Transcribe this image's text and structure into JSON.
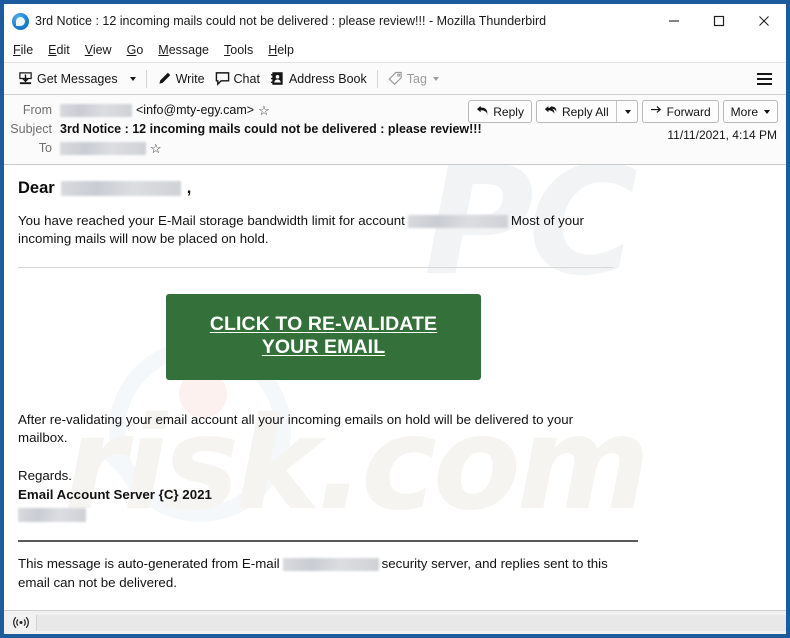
{
  "window": {
    "title": "3rd Notice : 12 incoming mails could not be delivered : please review!!! - Mozilla Thunderbird",
    "app_logo_icon": "thunderbird-icon",
    "controls": {
      "minimize": "minimize-icon",
      "maximize": "maximize-icon",
      "close": "close-icon"
    },
    "border_color": "#1b5b9e"
  },
  "menubar": {
    "items": [
      {
        "label": "File",
        "accel": "F"
      },
      {
        "label": "Edit",
        "accel": "E"
      },
      {
        "label": "View",
        "accel": "V"
      },
      {
        "label": "Go",
        "accel": "G"
      },
      {
        "label": "Message",
        "accel": "M"
      },
      {
        "label": "Tools",
        "accel": "T"
      },
      {
        "label": "Help",
        "accel": "H"
      }
    ]
  },
  "toolbar": {
    "get_messages": "Get Messages",
    "write": "Write",
    "chat": "Chat",
    "address_book": "Address Book",
    "tag": "Tag",
    "tag_disabled": true,
    "app_menu_icon": "hamburger-icon"
  },
  "message_header": {
    "from_label": "From",
    "from_name_redacted": true,
    "from_address": "<info@mty-egy.cam>",
    "subject_label": "Subject",
    "subject": "3rd Notice : 12 incoming mails could not be delivered : please review!!!",
    "to_label": "To",
    "to_redacted": true,
    "date": "11/11/2021, 4:14 PM",
    "actions": {
      "reply": "Reply",
      "reply_all": "Reply All",
      "forward": "Forward",
      "more": "More"
    }
  },
  "email_body": {
    "greeting_prefix": "Dear",
    "greeting_suffix": ",",
    "paragraph_1_before": "You have reached your E-Mail storage bandwidth limit for account",
    "paragraph_1_after": "Most of your incoming mails will now be placed on hold.",
    "cta_label": "CLICK TO RE-VALIDATE YOUR EMAIL",
    "cta_color": "#33703a",
    "paragraph_2": "After re-validating your email account all your incoming emails on hold will be delivered to your mailbox.",
    "regards": "Regards.",
    "signature": "Email Account Server {C} 2021",
    "footer_before": "This message is auto-generated from E-mail",
    "footer_after": "security server, and replies sent to this email can not be delivered."
  },
  "statusbar": {
    "icon": "broadcast-icon"
  }
}
